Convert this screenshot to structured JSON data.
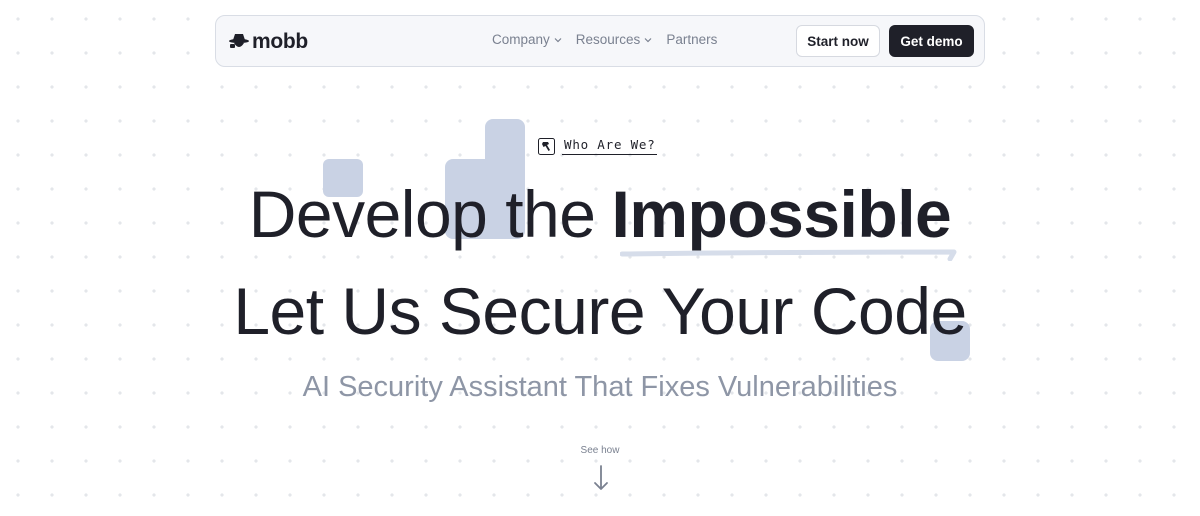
{
  "nav": {
    "logo_text": "mobb",
    "menu": [
      {
        "label": "Company",
        "has_dropdown": true
      },
      {
        "label": "Resources",
        "has_dropdown": true
      },
      {
        "label": "Partners",
        "has_dropdown": false
      }
    ],
    "start_label": "Start now",
    "demo_label": "Get demo"
  },
  "hero": {
    "badge": "Who Are We?",
    "line1_light": "Develop the",
    "line1_bold": "Impossible",
    "line2": "Let Us Secure Your Code",
    "subtitle": "AI Security Assistant That Fixes Vulnerabilities",
    "see_how": "See how"
  },
  "colors": {
    "dark": "#1f2029",
    "muted": "#8e96a6",
    "accent_block": "#c9d2e4",
    "nav_bg": "#f6f7fa"
  },
  "icons": [
    "mobb-logo-icon",
    "chevron-down-icon",
    "hammer-badge-icon",
    "arrow-down-icon"
  ]
}
